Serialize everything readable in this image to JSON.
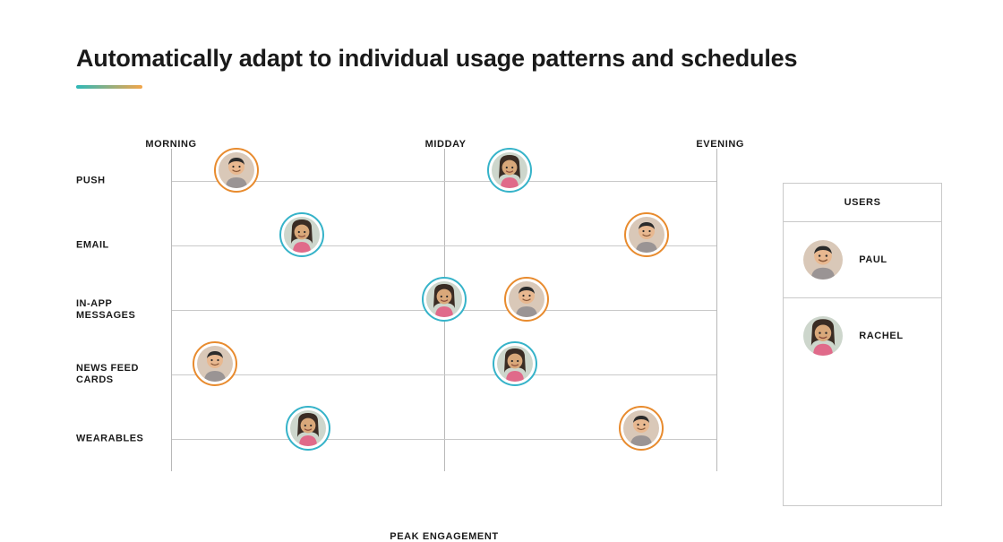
{
  "title": "Automatically adapt to individual usage patterns and schedules",
  "time_axis": [
    "MORNING",
    "MIDDAY",
    "EVENING"
  ],
  "rows": [
    "PUSH",
    "EMAIL",
    "IN-APP MESSAGES",
    "NEWS FEED CARDS",
    "WEARABLES"
  ],
  "footer": "PEAK ENGAGEMENT",
  "legend_title": "USERS",
  "users": [
    {
      "id": "paul",
      "name": "PAUL",
      "color": "#e88b2e"
    },
    {
      "id": "rachel",
      "name": "RACHEL",
      "color": "#36b3c9"
    }
  ],
  "chart_data": {
    "type": "scatter",
    "title": "Peak engagement by channel and time of day",
    "xlabel": "PEAK ENGAGEMENT",
    "ylabel": "",
    "x_categories": [
      "MORNING",
      "MIDDAY",
      "EVENING"
    ],
    "y_categories": [
      "PUSH",
      "EMAIL",
      "IN-APP MESSAGES",
      "NEWS FEED CARDS",
      "WEARABLES"
    ],
    "x_range": [
      0,
      100
    ],
    "series": [
      {
        "name": "PAUL",
        "color": "#e88b2e",
        "points": [
          {
            "channel": "PUSH",
            "x": 12
          },
          {
            "channel": "EMAIL",
            "x": 87
          },
          {
            "channel": "IN-APP MESSAGES",
            "x": 65
          },
          {
            "channel": "NEWS FEED CARDS",
            "x": 8
          },
          {
            "channel": "WEARABLES",
            "x": 86
          }
        ]
      },
      {
        "name": "RACHEL",
        "color": "#36b3c9",
        "points": [
          {
            "channel": "PUSH",
            "x": 62
          },
          {
            "channel": "EMAIL",
            "x": 24
          },
          {
            "channel": "IN-APP MESSAGES",
            "x": 50
          },
          {
            "channel": "NEWS FEED CARDS",
            "x": 63
          },
          {
            "channel": "WEARABLES",
            "x": 25
          }
        ]
      }
    ]
  }
}
